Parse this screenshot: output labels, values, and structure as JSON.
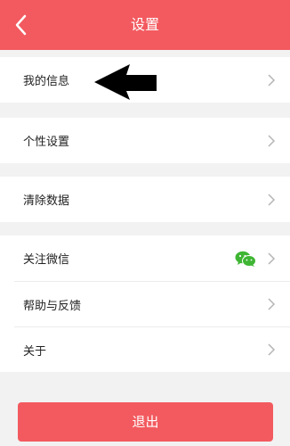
{
  "header": {
    "title": "设置",
    "back_icon": "chevron-left-icon",
    "background": "#f25a5f"
  },
  "settings": {
    "items": [
      {
        "label": "我的信息"
      },
      {
        "label": "个性设置"
      },
      {
        "label": "清除数据"
      },
      {
        "label": "关注微信",
        "trailing_icon": "wechat-icon"
      },
      {
        "label": "帮助与反馈"
      },
      {
        "label": "关于"
      }
    ]
  },
  "annotation": {
    "icon": "arrow-left-icon",
    "color": "#000000"
  },
  "footer": {
    "logout_label": "退出",
    "button_color": "#f25a5f"
  }
}
